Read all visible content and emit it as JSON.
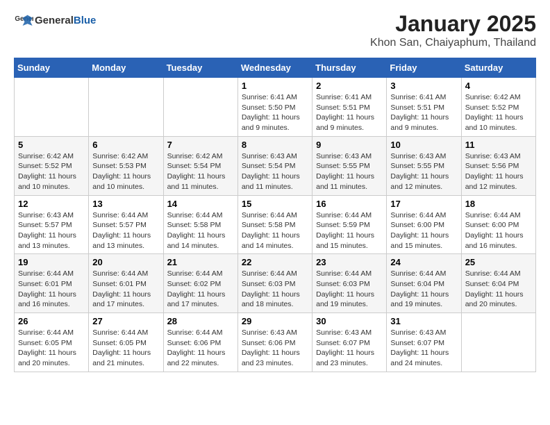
{
  "logo": {
    "general": "General",
    "blue": "Blue"
  },
  "title": "January 2025",
  "subtitle": "Khon San, Chaiyaphum, Thailand",
  "weekdays": [
    "Sunday",
    "Monday",
    "Tuesday",
    "Wednesday",
    "Thursday",
    "Friday",
    "Saturday"
  ],
  "weeks": [
    [
      {
        "day": "",
        "info": ""
      },
      {
        "day": "",
        "info": ""
      },
      {
        "day": "",
        "info": ""
      },
      {
        "day": "1",
        "info": "Sunrise: 6:41 AM\nSunset: 5:50 PM\nDaylight: 11 hours and 9 minutes."
      },
      {
        "day": "2",
        "info": "Sunrise: 6:41 AM\nSunset: 5:51 PM\nDaylight: 11 hours and 9 minutes."
      },
      {
        "day": "3",
        "info": "Sunrise: 6:41 AM\nSunset: 5:51 PM\nDaylight: 11 hours and 9 minutes."
      },
      {
        "day": "4",
        "info": "Sunrise: 6:42 AM\nSunset: 5:52 PM\nDaylight: 11 hours and 10 minutes."
      }
    ],
    [
      {
        "day": "5",
        "info": "Sunrise: 6:42 AM\nSunset: 5:52 PM\nDaylight: 11 hours and 10 minutes."
      },
      {
        "day": "6",
        "info": "Sunrise: 6:42 AM\nSunset: 5:53 PM\nDaylight: 11 hours and 10 minutes."
      },
      {
        "day": "7",
        "info": "Sunrise: 6:42 AM\nSunset: 5:54 PM\nDaylight: 11 hours and 11 minutes."
      },
      {
        "day": "8",
        "info": "Sunrise: 6:43 AM\nSunset: 5:54 PM\nDaylight: 11 hours and 11 minutes."
      },
      {
        "day": "9",
        "info": "Sunrise: 6:43 AM\nSunset: 5:55 PM\nDaylight: 11 hours and 11 minutes."
      },
      {
        "day": "10",
        "info": "Sunrise: 6:43 AM\nSunset: 5:55 PM\nDaylight: 11 hours and 12 minutes."
      },
      {
        "day": "11",
        "info": "Sunrise: 6:43 AM\nSunset: 5:56 PM\nDaylight: 11 hours and 12 minutes."
      }
    ],
    [
      {
        "day": "12",
        "info": "Sunrise: 6:43 AM\nSunset: 5:57 PM\nDaylight: 11 hours and 13 minutes."
      },
      {
        "day": "13",
        "info": "Sunrise: 6:44 AM\nSunset: 5:57 PM\nDaylight: 11 hours and 13 minutes."
      },
      {
        "day": "14",
        "info": "Sunrise: 6:44 AM\nSunset: 5:58 PM\nDaylight: 11 hours and 14 minutes."
      },
      {
        "day": "15",
        "info": "Sunrise: 6:44 AM\nSunset: 5:58 PM\nDaylight: 11 hours and 14 minutes."
      },
      {
        "day": "16",
        "info": "Sunrise: 6:44 AM\nSunset: 5:59 PM\nDaylight: 11 hours and 15 minutes."
      },
      {
        "day": "17",
        "info": "Sunrise: 6:44 AM\nSunset: 6:00 PM\nDaylight: 11 hours and 15 minutes."
      },
      {
        "day": "18",
        "info": "Sunrise: 6:44 AM\nSunset: 6:00 PM\nDaylight: 11 hours and 16 minutes."
      }
    ],
    [
      {
        "day": "19",
        "info": "Sunrise: 6:44 AM\nSunset: 6:01 PM\nDaylight: 11 hours and 16 minutes."
      },
      {
        "day": "20",
        "info": "Sunrise: 6:44 AM\nSunset: 6:01 PM\nDaylight: 11 hours and 17 minutes."
      },
      {
        "day": "21",
        "info": "Sunrise: 6:44 AM\nSunset: 6:02 PM\nDaylight: 11 hours and 17 minutes."
      },
      {
        "day": "22",
        "info": "Sunrise: 6:44 AM\nSunset: 6:03 PM\nDaylight: 11 hours and 18 minutes."
      },
      {
        "day": "23",
        "info": "Sunrise: 6:44 AM\nSunset: 6:03 PM\nDaylight: 11 hours and 19 minutes."
      },
      {
        "day": "24",
        "info": "Sunrise: 6:44 AM\nSunset: 6:04 PM\nDaylight: 11 hours and 19 minutes."
      },
      {
        "day": "25",
        "info": "Sunrise: 6:44 AM\nSunset: 6:04 PM\nDaylight: 11 hours and 20 minutes."
      }
    ],
    [
      {
        "day": "26",
        "info": "Sunrise: 6:44 AM\nSunset: 6:05 PM\nDaylight: 11 hours and 20 minutes."
      },
      {
        "day": "27",
        "info": "Sunrise: 6:44 AM\nSunset: 6:05 PM\nDaylight: 11 hours and 21 minutes."
      },
      {
        "day": "28",
        "info": "Sunrise: 6:44 AM\nSunset: 6:06 PM\nDaylight: 11 hours and 22 minutes."
      },
      {
        "day": "29",
        "info": "Sunrise: 6:43 AM\nSunset: 6:06 PM\nDaylight: 11 hours and 23 minutes."
      },
      {
        "day": "30",
        "info": "Sunrise: 6:43 AM\nSunset: 6:07 PM\nDaylight: 11 hours and 23 minutes."
      },
      {
        "day": "31",
        "info": "Sunrise: 6:43 AM\nSunset: 6:07 PM\nDaylight: 11 hours and 24 minutes."
      },
      {
        "day": "",
        "info": ""
      }
    ]
  ]
}
